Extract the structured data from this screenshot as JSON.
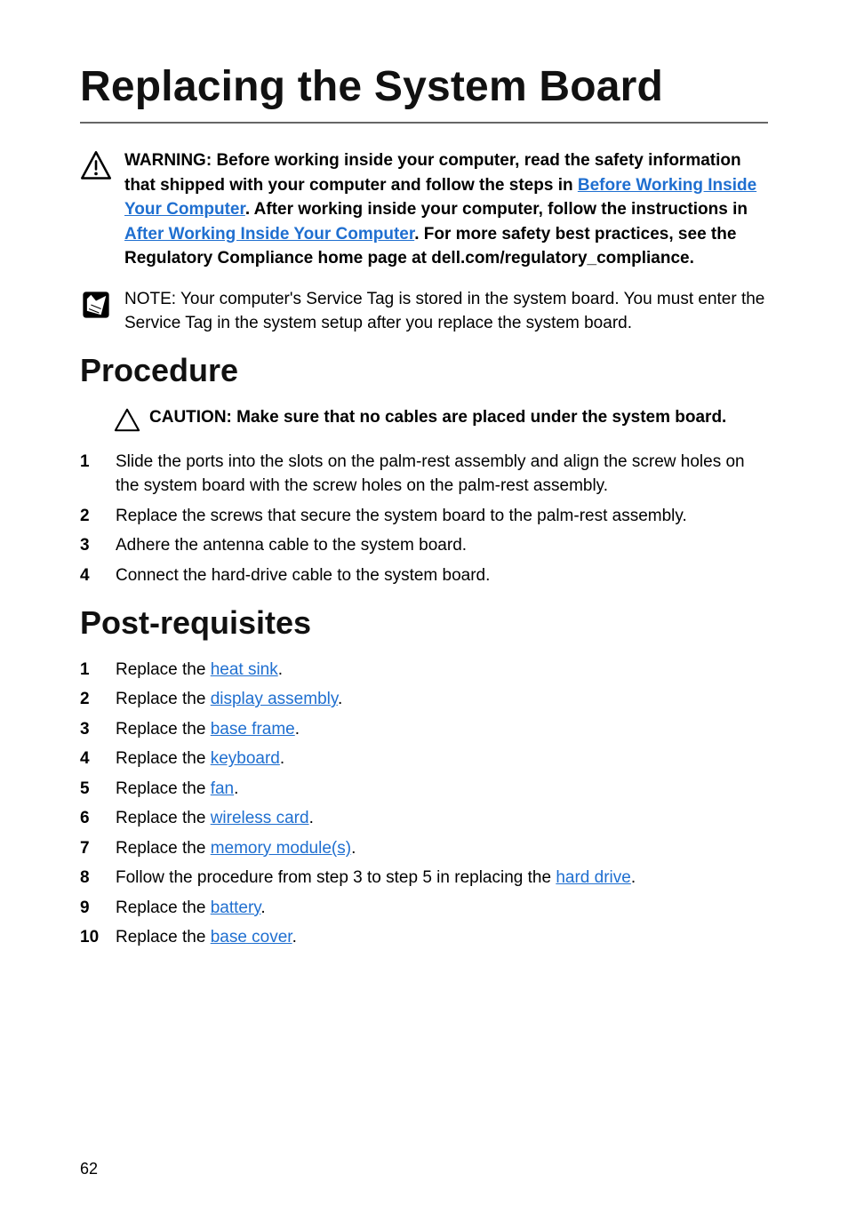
{
  "title": "Replacing the System Board",
  "warning": {
    "label": "WARNING: ",
    "part1": "Before working inside your computer, read the safety information that shipped with your computer and follow the steps in ",
    "link1": "Before Working Inside Your Computer",
    "part2": ". After working inside your computer, follow the instructions in ",
    "link2": "After Working Inside Your Computer",
    "part3": ". For more safety best practices, see the Regulatory Compliance home page at dell.com/regulatory_compliance."
  },
  "note": {
    "label": "NOTE: ",
    "body": "Your computer's Service Tag is stored in the system board. You must enter the Service Tag in the system setup after you replace the system board."
  },
  "procedure": {
    "heading": "Procedure",
    "caution": "CAUTION: Make sure that no cables are placed under the system board.",
    "steps": [
      "Slide the ports into the slots on the palm-rest assembly and align the screw holes on the system board with the screw holes on the palm-rest assembly.",
      "Replace the screws that secure the system board to the palm-rest assembly.",
      "Adhere the antenna cable to the system board.",
      "Connect the hard-drive cable to the system board."
    ]
  },
  "postreq": {
    "heading": "Post-requisites",
    "num1": "1",
    "num2": "2",
    "num3": "3",
    "num4": "4",
    "num5": "5",
    "num6": "6",
    "num7": "7",
    "num8": "8",
    "num9": "9",
    "num10": "10",
    "r1a": "Replace the ",
    "r1l": "heat sink",
    "r2a": "Replace the ",
    "r2l": "display assembly",
    "r3a": "Replace the ",
    "r3l": "base frame",
    "r4a": "Replace the ",
    "r4l": "keyboard",
    "r5a": "Replace the ",
    "r5l": "fan",
    "r6a": "Replace the ",
    "r6l": "wireless card",
    "r7a": "Replace the ",
    "r7l": "memory module(s)",
    "r8a": "Follow the procedure from step 3 to step 5 in replacing the ",
    "r8l": "hard drive",
    "r9a": "Replace the ",
    "r9l": "battery",
    "r10a": "Replace the ",
    "r10l": "base cover",
    "period": "."
  },
  "page_number": "62"
}
